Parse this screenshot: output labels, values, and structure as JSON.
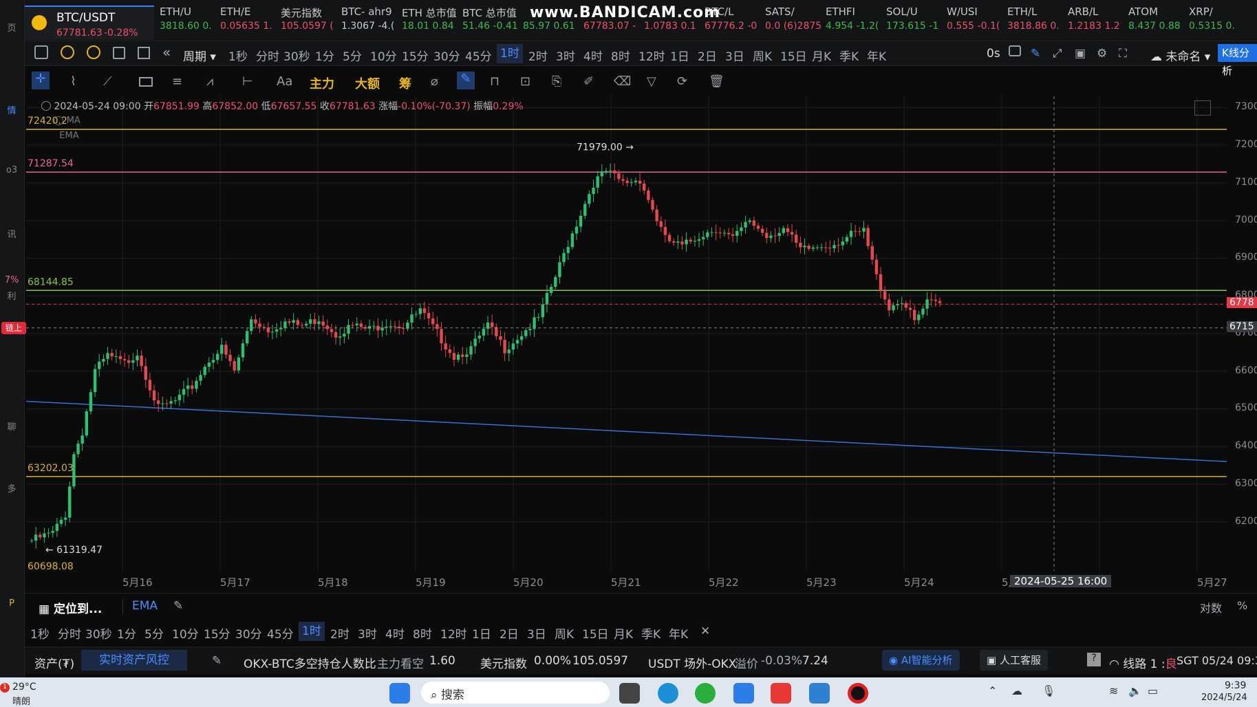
{
  "left_rail": {
    "items": [
      "页",
      "情",
      "o3",
      "讯",
      "7%",
      "利",
      "链上",
      "聊",
      "多",
      "P"
    ]
  },
  "watermark": "www.BANDICAM.com",
  "main_ticker": {
    "symbol": "BTC/USDT",
    "price": "67781.63",
    "change": "-0.28%"
  },
  "tickers": [
    {
      "name": "ETH/U",
      "p1": "3818.60",
      "p2": "0.",
      "dir": "up"
    },
    {
      "name": "ETH/E",
      "p1": "0.05635",
      "p2": "1.",
      "dir": "dn"
    },
    {
      "name": "美元指数",
      "p1": "105.0597",
      "p2": "(",
      "dir": "dn"
    },
    {
      "name": "BTC- ahr9",
      "p1": "1.3067",
      "p2": "-4.(",
      "dir": "neutral"
    },
    {
      "name": "ETH 总市值",
      "p1": "18.01",
      "p2": "0.84",
      "dir": "up"
    },
    {
      "name": "BTC 总市值",
      "p1": "51.46",
      "p2": "-0.41",
      "dir": "up"
    },
    {
      "name": "",
      "p1": "85.97",
      "p2": "0.61",
      "dir": "up"
    },
    {
      "name": "",
      "p1": "67783.07",
      "p2": "-",
      "dir": "dn"
    },
    {
      "name": "",
      "p1": "1.0783",
      "p2": "0.1",
      "dir": "dn"
    },
    {
      "name": "BTC/L",
      "p1": "67776.2",
      "p2": "-0",
      "dir": "dn"
    },
    {
      "name": "SATS/",
      "p1": "0.0",
      "p2": "(6)2875",
      "dir": "dn"
    },
    {
      "name": "ETHFI",
      "p1": "4.954",
      "p2": "-1.2(",
      "dir": "up"
    },
    {
      "name": "SOL/U",
      "p1": "173.615",
      "p2": "-1",
      "dir": "up"
    },
    {
      "name": "W/USI",
      "p1": "0.555",
      "p2": "-0.1(",
      "dir": "dn"
    },
    {
      "name": "ETH/L",
      "p1": "3818.86",
      "p2": "0.",
      "dir": "dn"
    },
    {
      "name": "ARB/L",
      "p1": "1.2183",
      "p2": "1.2",
      "dir": "dn"
    },
    {
      "name": "ATOM",
      "p1": "8.437",
      "p2": "0.88",
      "dir": "up"
    },
    {
      "name": "XRP/",
      "p1": "0.5315",
      "p2": "0.",
      "dir": "up"
    }
  ],
  "period_bar": {
    "label": "周期",
    "periods": [
      "1秒",
      "分时",
      "30秒",
      "1分",
      "5分",
      "10分",
      "15分",
      "30分",
      "45分",
      "1时",
      "2时",
      "3时",
      "4时",
      "8时",
      "12时",
      "1日",
      "2日",
      "3日",
      "周K",
      "15日",
      "月K",
      "季K",
      "年K"
    ],
    "active": "1时",
    "countdown": "0s",
    "layout_name": "未命名",
    "k_analysis": "K线分析"
  },
  "toolbar2": {
    "text_tool": "Aa",
    "main_force": "主力",
    "big_order": "大额",
    "chips": "筹"
  },
  "info_line": {
    "datetime": "2024-05-24 09:00",
    "open_label": "开",
    "open": "67851.99",
    "high_label": "高",
    "high": "67852.00",
    "low_label": "低",
    "low": "67657.55",
    "close_label": "收",
    "close": "67781.63",
    "chg_label": "涨幅",
    "chg": "-0.10%(-70.37)",
    "amp_label": "振幅",
    "amp": "0.29%",
    "ma": "MA",
    "ema": "EMA"
  },
  "chart_data": {
    "type": "candlestick",
    "interval": "1h",
    "x_ticks": [
      "5月16",
      "5月17",
      "5月18",
      "5月19",
      "5月20",
      "5月21",
      "5月22",
      "5月23",
      "5月24",
      "5月25",
      "5月27"
    ],
    "y_ticks": [
      7300,
      7200,
      7100,
      7000,
      6900,
      6800,
      6700,
      6600,
      6500,
      6400,
      6300,
      6200
    ],
    "ylim": [
      60698.08,
      73300
    ],
    "crosshair_time": "2024-05-25 16:00",
    "crosshair_price_label": "6715",
    "last_price_label": "6778",
    "horizontal_lines": [
      {
        "label": "72420.2",
        "value": 72420.2,
        "color": "#d6b23a"
      },
      {
        "label": "71287.54",
        "value": 71287.54,
        "color": "#e36a8f"
      },
      {
        "label": "68144.85",
        "value": 68144.85,
        "color": "#8bc34a"
      },
      {
        "label": "63202.03",
        "value": 63202.03,
        "color": "#d6b23a"
      }
    ],
    "annotations": {
      "high": "71979.00",
      "low": "61319.47",
      "bottom": "60698.08"
    },
    "trendline": {
      "from": [
        0,
        65200
      ],
      "to": [
        1,
        63600
      ],
      "color": "#3b6fd6"
    },
    "close_path": [
      [
        0,
        61500
      ],
      [
        5,
        61700
      ],
      [
        8,
        62200
      ],
      [
        10,
        63800
      ],
      [
        12,
        64400
      ],
      [
        15,
        66000
      ],
      [
        18,
        66400
      ],
      [
        22,
        66200
      ],
      [
        25,
        66500
      ],
      [
        28,
        65600
      ],
      [
        30,
        65000
      ],
      [
        34,
        65200
      ],
      [
        38,
        65600
      ],
      [
        42,
        66300
      ],
      [
        45,
        66600
      ],
      [
        48,
        66000
      ],
      [
        52,
        67400
      ],
      [
        56,
        67100
      ],
      [
        60,
        67300
      ],
      [
        64,
        67200
      ],
      [
        68,
        67400
      ],
      [
        72,
        67000
      ],
      [
        76,
        67200
      ],
      [
        80,
        67100
      ],
      [
        84,
        67300
      ],
      [
        88,
        67200
      ],
      [
        92,
        67600
      ],
      [
        96,
        67000
      ],
      [
        100,
        66400
      ],
      [
        104,
        66600
      ],
      [
        108,
        67200
      ],
      [
        112,
        66600
      ],
      [
        116,
        67000
      ],
      [
        120,
        67400
      ],
      [
        124,
        68500
      ],
      [
        127,
        69400
      ],
      [
        130,
        70200
      ],
      [
        133,
        71000
      ],
      [
        136,
        71300
      ],
      [
        140,
        71000
      ],
      [
        144,
        71100
      ],
      [
        147,
        70300
      ],
      [
        150,
        69500
      ],
      [
        154,
        69300
      ],
      [
        158,
        69600
      ],
      [
        162,
        69800
      ],
      [
        166,
        69500
      ],
      [
        170,
        70000
      ],
      [
        174,
        69600
      ],
      [
        178,
        69800
      ],
      [
        182,
        69200
      ],
      [
        186,
        69300
      ],
      [
        190,
        69400
      ],
      [
        194,
        69600
      ],
      [
        197,
        69700
      ],
      [
        200,
        68500
      ],
      [
        203,
        67700
      ],
      [
        206,
        67900
      ],
      [
        209,
        67300
      ],
      [
        212,
        67800
      ],
      [
        215,
        67780
      ]
    ]
  },
  "bottom_bar1": {
    "locate": "定位到...",
    "ema_tab": "EMA",
    "log": "对数",
    "pct": "%"
  },
  "bottom_bar2": {
    "periods": [
      "1秒",
      "分时",
      "30秒",
      "1分",
      "5分",
      "10分",
      "15分",
      "30分",
      "45分",
      "1时",
      "2时",
      "3时",
      "4时",
      "8时",
      "12时",
      "1日",
      "2日",
      "3日",
      "周K",
      "15日",
      "月K",
      "季K",
      "年K"
    ],
    "active": "1时"
  },
  "status_bar": {
    "assets": "资产(₮)",
    "risk_btn": "实时资产风控",
    "okx_ratio_label": "OKX-BTC多空持仓人数比",
    "main_view": "主力看空",
    "ratio": "1.60",
    "dxy_label": "美元指数",
    "dxy_chg": "0.00%",
    "dxy": "105.0597",
    "usdt_label": "USDT 场外-OKX",
    "premium_label": "溢价",
    "premium": "-0.03%",
    "usdt_price": "7.24",
    "ai": "AI智能分析",
    "service": "人工客服",
    "line": "线路 1 :",
    "line_quality": "良",
    "clock": "SGT  05/24 09:3"
  },
  "taskbar": {
    "temp": "29°C",
    "weather": "晴朗",
    "search": "搜索",
    "time": "9:39",
    "date": "2024/5/24",
    "badge": "1"
  }
}
